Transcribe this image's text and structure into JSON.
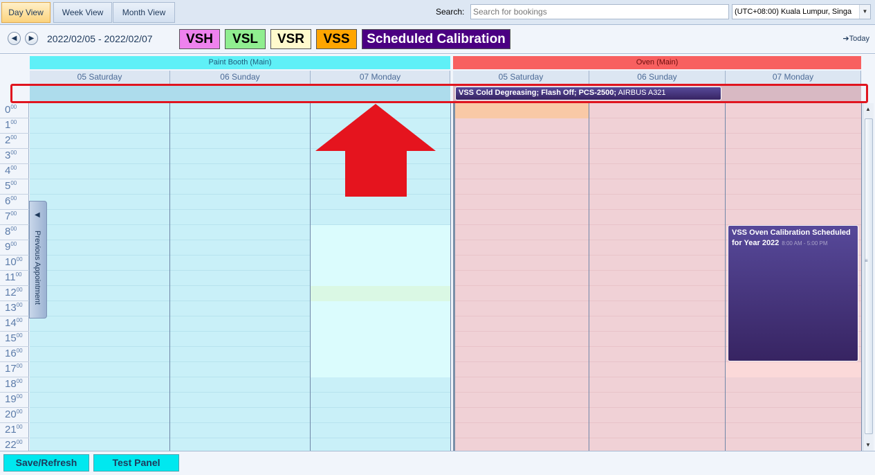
{
  "toolbar": {
    "tabs": [
      "Day View",
      "Week View",
      "Month View"
    ],
    "search_label": "Search:",
    "search_placeholder": "Search for bookings",
    "timezone": "(UTC+08:00) Kuala Lumpur, Singa"
  },
  "header": {
    "date_range": "2022/02/05 - 2022/02/07",
    "legend": [
      {
        "label": "VSH",
        "color": "#ee82ee"
      },
      {
        "label": "VSL",
        "color": "#90ee90"
      },
      {
        "label": "VSR",
        "color": "#fffacd"
      },
      {
        "label": "VSS",
        "color": "#ffa500"
      },
      {
        "label": "Scheduled Calibration",
        "color": "#4b0082"
      }
    ],
    "today_label": "Today"
  },
  "resources": [
    {
      "name": "Paint Booth (Main)",
      "color": "#5ff0f7",
      "days": [
        "05 Saturday",
        "06 Sunday",
        "07 Monday"
      ]
    },
    {
      "name": "Oven (Main)",
      "color": "#f86060",
      "days": [
        "05 Saturday",
        "06 Sunday",
        "07 Monday"
      ]
    }
  ],
  "hours": [
    "0",
    "1",
    "2",
    "3",
    "4",
    "5",
    "6",
    "7",
    "8",
    "9",
    "10",
    "11",
    "12",
    "13",
    "14",
    "15",
    "16",
    "17",
    "18",
    "19",
    "20",
    "21",
    "22"
  ],
  "hour_suffix": "00",
  "appointments": {
    "all_day": {
      "bold": "VSS  Cold Degreasing; Flash Off;  PCS-2500;",
      "light": " AIRBUS A321"
    },
    "calibration": {
      "title": "VSS  Oven Calibration Scheduled for Year 2022",
      "time": "8:00 AM - 5:00 PM"
    }
  },
  "side_tab": "Previous Appointment",
  "bottom": {
    "save": "Save/Refresh",
    "test": "Test Panel"
  }
}
